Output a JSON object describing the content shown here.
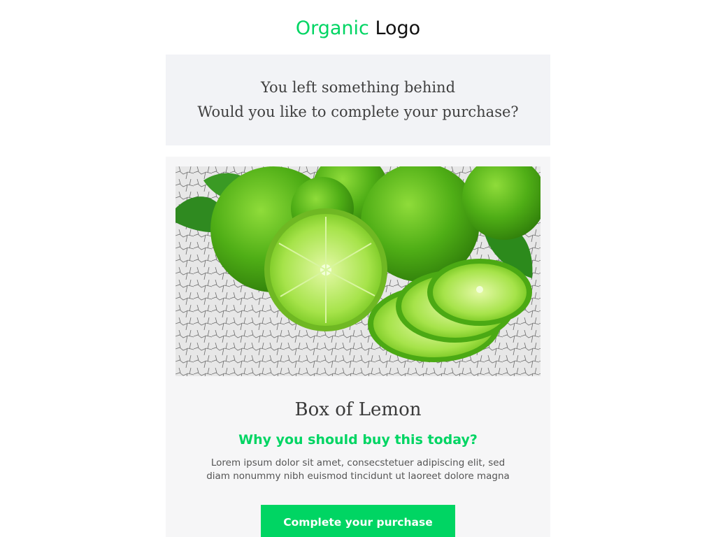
{
  "header": {
    "logo_word_1": "Organic",
    "logo_word_2": "Logo"
  },
  "banner": {
    "line_1": "You left something behind",
    "line_2": "Would you like to complete your purchase?"
  },
  "product": {
    "image_subject": "limes",
    "title": "Box of Lemon",
    "subtitle": "Why you should buy this today?",
    "description_line_1": "Lorem ipsum dolor sit amet, consecstetuer adipiscing elit, sed",
    "description_line_2": "diam nonummy nibh euismod tincidunt ut laoreet dolore magna"
  },
  "cta": {
    "label": "Complete your purchase"
  },
  "colors": {
    "brand_green": "#00d563",
    "banner_bg": "#f2f3f6",
    "card_bg": "#f6f6f7",
    "text_dark": "#3f3f3f"
  }
}
